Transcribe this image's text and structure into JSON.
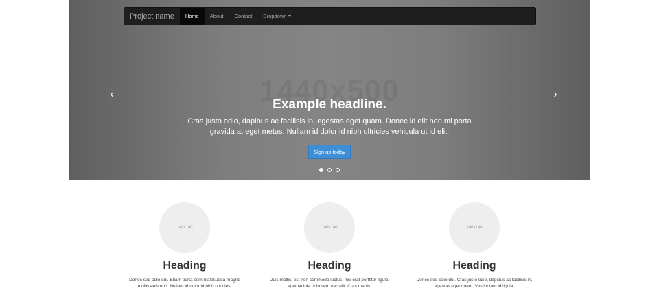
{
  "navbar": {
    "brand": "Project name",
    "items": [
      {
        "label": "Home",
        "active": true
      },
      {
        "label": "About",
        "active": false
      },
      {
        "label": "Contact",
        "active": false
      },
      {
        "label": "Dropdown",
        "active": false
      }
    ]
  },
  "carousel": {
    "watermark": "1440x500",
    "headline": "Example headline.",
    "lead": "Cras justo odio, dapibus ac facilisis in, egestas eget quam. Donec id elit non mi porta gravida at eget metus. Nullam id dolor id nibh ultricies vehicula ut id elit.",
    "cta_label": "Sign up today",
    "prev_icon": "chevron-left-icon",
    "next_icon": "chevron-right-icon",
    "indicators": {
      "count": 3,
      "active_index": 0
    }
  },
  "features": [
    {
      "placeholder": "140x140",
      "heading": "Heading",
      "text": "Donec sed odio dui. Etiam porta sem malesuada magna mollis euismod. Nullam id dolor id nibh ultricies."
    },
    {
      "placeholder": "140x140",
      "heading": "Heading",
      "text": "Duis mollis, est non commodo luctus, nisi erat porttitor ligula, eget lacinia odio sem nec elit. Cras mattis."
    },
    {
      "placeholder": "140x140",
      "heading": "Heading",
      "text": "Donec sed odio dui. Cras justo odio, dapibus ac facilisis in, egestas eget quam. Vestibulum id ligula."
    }
  ],
  "colors": {
    "navbar_bg": "#1e1e1e",
    "cta_bg": "#3e8fd6",
    "hero_bg": "#808080"
  }
}
